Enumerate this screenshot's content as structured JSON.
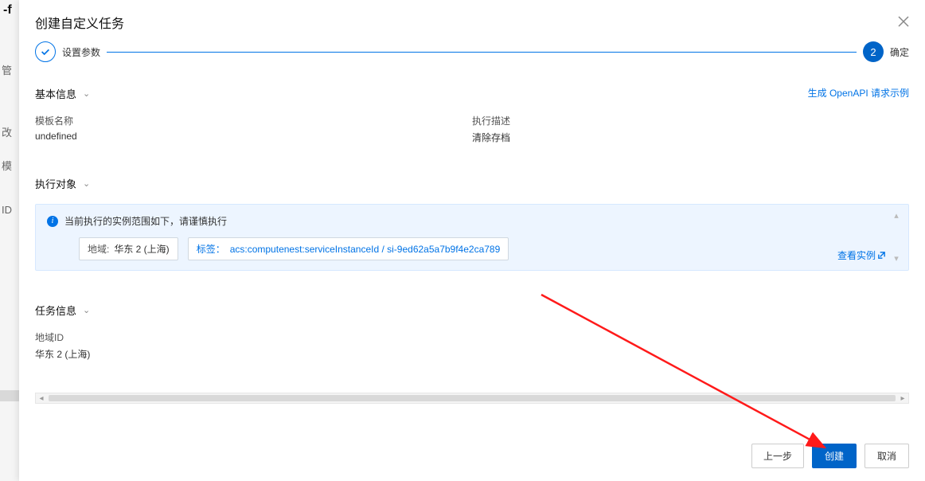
{
  "background": {
    "frag1": "-f",
    "frag2": "管",
    "frag3": "改",
    "frag4": "模",
    "frag5": "ID"
  },
  "modal": {
    "title": "创建自定义任务",
    "steps": {
      "step1_label": "设置参数",
      "step2_number": "2",
      "step2_label": "确定"
    },
    "openapi_link": "生成 OpenAPI 请求示例",
    "sections": {
      "basic": {
        "title": "基本信息",
        "template_name_label": "模板名称",
        "template_name_value": "undefined",
        "exec_desc_label": "执行描述",
        "exec_desc_value": "清除存档"
      },
      "target": {
        "title": "执行对象",
        "notice": "当前执行的实例范围如下，请谨慎执行",
        "region_chip_key": "地域:",
        "region_chip_value": "华东 2 (上海)",
        "tag_chip_key": "标签：",
        "tag_chip_value": "acs:computenest:serviceInstanceId / si-9ed62a5a7b9f4e2ca789",
        "view_instances": "查看实例"
      },
      "task": {
        "title": "任务信息",
        "region_id_label": "地域ID",
        "region_id_value": "华东 2 (上海)"
      }
    },
    "footer": {
      "prev": "上一步",
      "create": "创建",
      "cancel": "取消"
    }
  }
}
